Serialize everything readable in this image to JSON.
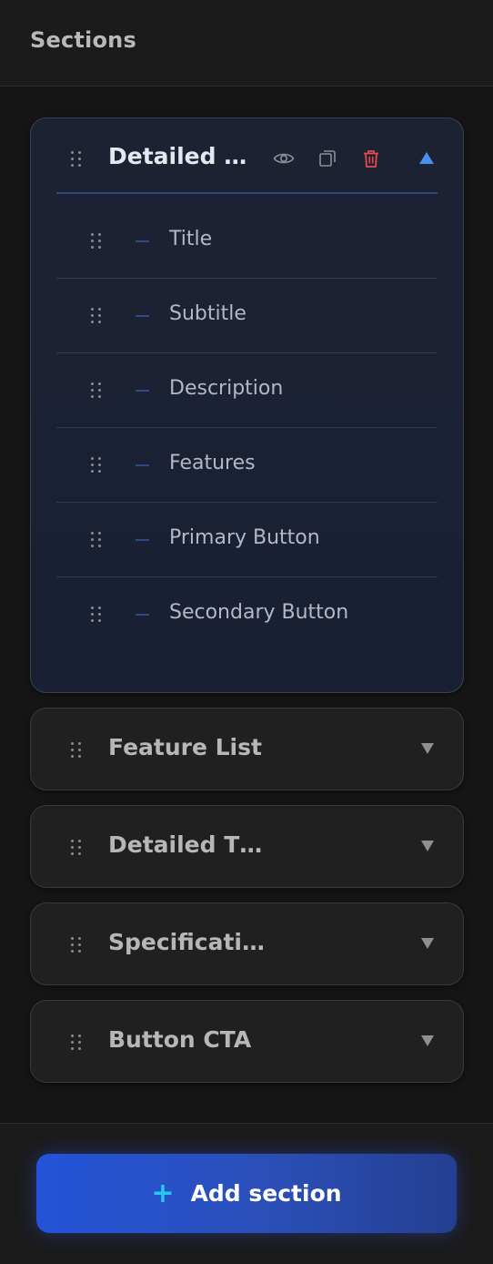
{
  "header": {
    "title": "Sections"
  },
  "colors": {
    "accent": "#4b8ef0",
    "danger": "#e84848",
    "button_primary": "#2453d8",
    "plus": "#29c7f0"
  },
  "expanded_section": {
    "title": "Detailed In…",
    "actions": [
      "eye-icon",
      "duplicate-icon",
      "trash-icon"
    ],
    "items": [
      {
        "label": "Title"
      },
      {
        "label": "Subtitle"
      },
      {
        "label": "Description"
      },
      {
        "label": "Features"
      },
      {
        "label": "Primary Button"
      },
      {
        "label": "Secondary Button"
      }
    ]
  },
  "collapsed_sections": [
    {
      "title": "Feature List"
    },
    {
      "title": "Detailed T…"
    },
    {
      "title": "Specificati…"
    },
    {
      "title": "Button CTA"
    }
  ],
  "footer": {
    "add_button_plus": "+",
    "add_button_label": "Add section"
  }
}
